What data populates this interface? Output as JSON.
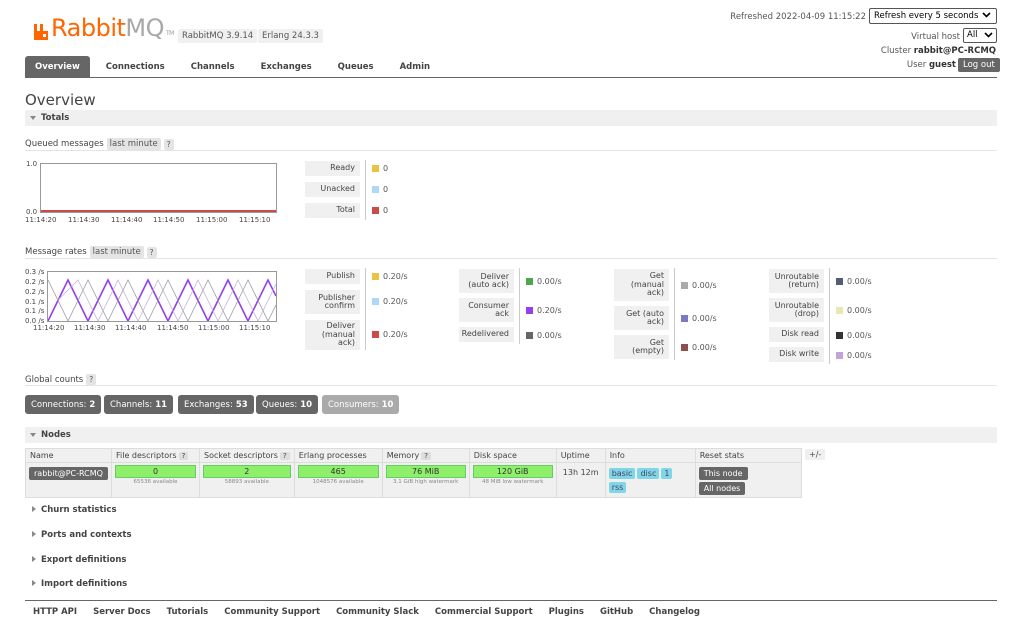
{
  "header": {
    "logo_rabbit": "Rabbit",
    "logo_mq": "MQ",
    "logo_tm": "TM",
    "version": "RabbitMQ 3.9.14",
    "erlang": "Erlang 24.3.3",
    "refreshed": "Refreshed 2022-04-09 11:15:22",
    "refresh_option": "Refresh every 5 seconds",
    "vhost_label": "Virtual host",
    "vhost_value": "All",
    "cluster_label": "Cluster",
    "cluster_value": "rabbit@PC-RCMQ",
    "user_label": "User",
    "user_value": "guest",
    "logout": "Log out"
  },
  "nav": {
    "tabs": [
      "Overview",
      "Connections",
      "Channels",
      "Exchanges",
      "Queues",
      "Admin"
    ]
  },
  "page_title": "Overview",
  "totals": {
    "heading": "Totals",
    "queued": {
      "label": "Queued messages",
      "range": "last minute",
      "help": "?",
      "y_ticks": [
        "1.0",
        "0.0"
      ],
      "x_ticks": [
        "11:14:20",
        "11:14:30",
        "11:14:40",
        "11:14:50",
        "11:15:00",
        "11:15:10"
      ],
      "legend": [
        {
          "label": "Ready",
          "value": "0",
          "color": "#edc240"
        },
        {
          "label": "Unacked",
          "value": "0",
          "color": "#afd8f8"
        },
        {
          "label": "Total",
          "value": "0",
          "color": "#cb4b4b"
        }
      ]
    },
    "rates": {
      "label": "Message rates",
      "range": "last minute",
      "help": "?",
      "y_ticks": [
        "0.3 /s",
        "0.2 /s",
        "0.2 /s",
        "0.1 /s",
        "0.1 /s",
        "0.0 /s"
      ],
      "x_ticks": [
        "11:14:20",
        "11:14:30",
        "11:14:40",
        "11:14:50",
        "11:15:00",
        "11:15:10"
      ],
      "col1": [
        {
          "label": "Publish",
          "value": "0.20/s",
          "color": "#edc240"
        },
        {
          "label": "Publisher confirm",
          "value": "0.20/s",
          "color": "#afd8f8"
        },
        {
          "label": "Deliver (manual ack)",
          "value": "0.20/s",
          "color": "#cb4b4b"
        }
      ],
      "col2": [
        {
          "label": "Deliver (auto ack)",
          "value": "0.00/s",
          "color": "#4da74d"
        },
        {
          "label": "Consumer ack",
          "value": "0.20/s",
          "color": "#9440ed"
        },
        {
          "label": "Redelivered",
          "value": "0.00/s",
          "color": "#666666"
        }
      ],
      "col3": [
        {
          "label": "Get (manual ack)",
          "value": "0.00/s",
          "color": "#aaaaaa"
        },
        {
          "label": "Get (auto ack)",
          "value": "0.00/s",
          "color": "#7c79c3"
        },
        {
          "label": "Get (empty)",
          "value": "0.00/s",
          "color": "#8d4f4f"
        }
      ],
      "col4": [
        {
          "label": "Unroutable (return)",
          "value": "0.00/s",
          "color": "#525f72"
        },
        {
          "label": "Unroutable (drop)",
          "value": "0.00/s",
          "color": "#e8e8b5"
        },
        {
          "label": "Disk read",
          "value": "0.00/s",
          "color": "#333333"
        },
        {
          "label": "Disk write",
          "value": "0.00/s",
          "color": "#c2a4d8"
        }
      ]
    }
  },
  "global_counts": {
    "label": "Global counts",
    "help": "?",
    "items": [
      {
        "label": "Connections:",
        "value": "2"
      },
      {
        "label": "Channels:",
        "value": "11"
      },
      {
        "label": "Exchanges:",
        "value": "53"
      },
      {
        "label": "Queues:",
        "value": "10"
      },
      {
        "label": "Consumers:",
        "value": "10"
      }
    ]
  },
  "nodes": {
    "heading": "Nodes",
    "columns": [
      "Name",
      "File descriptors",
      "Socket descriptors",
      "Erlang processes",
      "Memory",
      "Disk space",
      "Uptime",
      "Info",
      "Reset stats"
    ],
    "help": "?",
    "row": {
      "name": "rabbit@PC-RCMQ",
      "fd": "0",
      "fd_sub": "65536 available",
      "sd": "2",
      "sd_sub": "58893 available",
      "ep": "465",
      "ep_sub": "1048576 available",
      "mem": "76 MiB",
      "mem_sub": "3.1 GiB high watermark",
      "disk": "120 GiB",
      "disk_sub": "48 MiB low watermark",
      "uptime": "13h 12m",
      "info": [
        "basic",
        "disc",
        "1",
        "rss"
      ],
      "reset_this": "This node",
      "reset_all": "All nodes"
    },
    "plusminus": "+/-"
  },
  "collapsed_sections": [
    "Churn statistics",
    "Ports and contexts",
    "Export definitions",
    "Import definitions"
  ],
  "footer_links": [
    "HTTP API",
    "Server Docs",
    "Tutorials",
    "Community Support",
    "Community Slack",
    "Commercial Support",
    "Plugins",
    "GitHub",
    "Changelog"
  ]
}
